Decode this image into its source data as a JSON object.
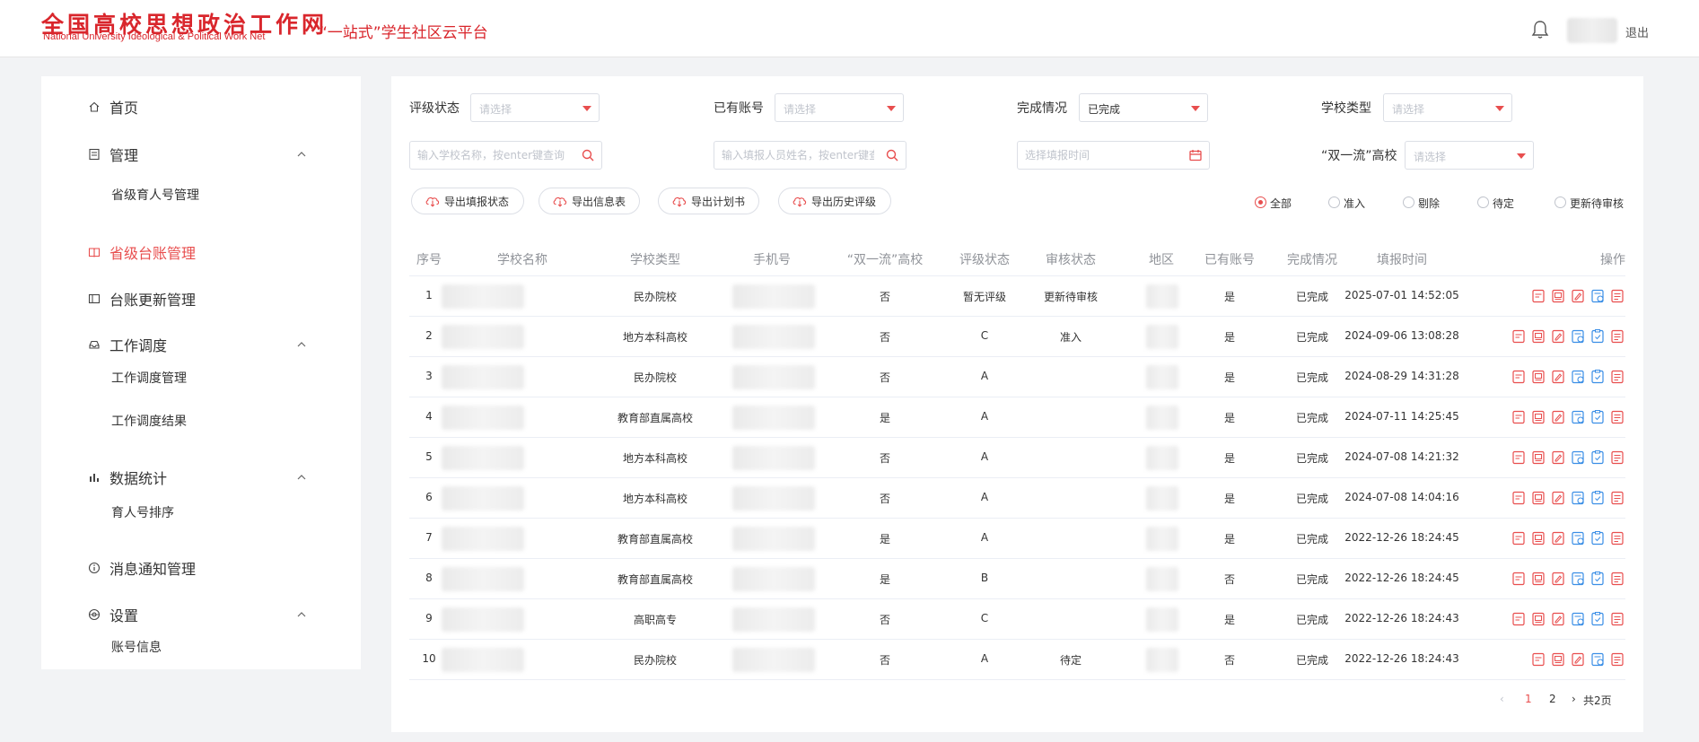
{
  "header": {
    "logo_cn": "全国高校思想政治工作网",
    "logo_en": "National University Ideological & Political Work Net",
    "platform": "“一站式”学生社区云平台",
    "logout": "退出"
  },
  "sidebar": {
    "items": [
      {
        "label": "首页",
        "icon": "home-icon"
      },
      {
        "label": "管理",
        "icon": "document-icon",
        "expanded": true,
        "children": [
          "省级育人号管理"
        ]
      },
      {
        "label": "省级台账管理",
        "icon": "book-icon",
        "active": true
      },
      {
        "label": "台账更新管理",
        "icon": "ledger-icon"
      },
      {
        "label": "工作调度",
        "icon": "tray-icon",
        "expanded": true,
        "children": [
          "工作调度管理",
          "工作调度结果"
        ]
      },
      {
        "label": "数据统计",
        "icon": "bar-chart-icon",
        "expanded": true,
        "children": [
          "育人号排序"
        ]
      },
      {
        "label": "消息通知管理",
        "icon": "info-icon"
      },
      {
        "label": "设置",
        "icon": "settings-icon",
        "expanded": true,
        "children": [
          "账号信息"
        ]
      }
    ]
  },
  "filters": {
    "rating_status": {
      "label": "评级状态",
      "placeholder": "请选择",
      "value": ""
    },
    "has_account": {
      "label": "已有账号",
      "placeholder": "请选择",
      "value": ""
    },
    "completion": {
      "label": "完成情况",
      "placeholder": "请选择",
      "value": "已完成"
    },
    "school_type": {
      "label": "学校类型",
      "placeholder": "请选择",
      "value": ""
    },
    "school_name_search": {
      "placeholder": "输入学校名称，按enter键查询"
    },
    "filler_name_search": {
      "placeholder": "输入填报人员姓名，按enter键查询"
    },
    "fill_time": {
      "placeholder": "选择填报时间"
    },
    "double_first_class": {
      "label": "“双一流”高校",
      "placeholder": "请选择",
      "value": ""
    }
  },
  "export_buttons": [
    "导出填报状态",
    "导出信息表",
    "导出计划书",
    "导出历史评级"
  ],
  "review_filter": {
    "options": [
      "全部",
      "准入",
      "剔除",
      "待定",
      "更新待审核"
    ],
    "selected": "全部"
  },
  "table": {
    "columns": [
      "序号",
      "学校名称",
      "学校类型",
      "手机号",
      "“双一流”高校",
      "评级状态",
      "审核状态",
      "地区",
      "已有账号",
      "完成情况",
      "填报时间",
      "操作"
    ],
    "rows": [
      {
        "no": "1",
        "type": "民办院校",
        "double": "否",
        "rating": "暂无评级",
        "review": "更新待审核",
        "account": "是",
        "done": "已完成",
        "time": "2025-07-01 14:52:05",
        "op_count": 5
      },
      {
        "no": "2",
        "type": "地方本科高校",
        "double": "否",
        "rating": "C",
        "review": "准入",
        "account": "是",
        "done": "已完成",
        "time": "2024-09-06 13:08:28",
        "op_count": 6
      },
      {
        "no": "3",
        "type": "民办院校",
        "double": "否",
        "rating": "A",
        "review": "",
        "account": "是",
        "done": "已完成",
        "time": "2024-08-29 14:31:28",
        "op_count": 6
      },
      {
        "no": "4",
        "type": "教育部直属高校",
        "double": "是",
        "rating": "A",
        "review": "",
        "account": "是",
        "done": "已完成",
        "time": "2024-07-11 14:25:45",
        "op_count": 6
      },
      {
        "no": "5",
        "type": "地方本科高校",
        "double": "否",
        "rating": "A",
        "review": "",
        "account": "是",
        "done": "已完成",
        "time": "2024-07-08 14:21:32",
        "op_count": 6
      },
      {
        "no": "6",
        "type": "地方本科高校",
        "double": "否",
        "rating": "A",
        "review": "",
        "account": "是",
        "done": "已完成",
        "time": "2024-07-08 14:04:16",
        "op_count": 6
      },
      {
        "no": "7",
        "type": "教育部直属高校",
        "double": "是",
        "rating": "A",
        "review": "",
        "account": "是",
        "done": "已完成",
        "time": "2022-12-26 18:24:45",
        "op_count": 6
      },
      {
        "no": "8",
        "type": "教育部直属高校",
        "double": "是",
        "rating": "B",
        "review": "",
        "account": "否",
        "done": "已完成",
        "time": "2022-12-26 18:24:45",
        "op_count": 6
      },
      {
        "no": "9",
        "type": "高职高专",
        "double": "否",
        "rating": "C",
        "review": "",
        "account": "是",
        "done": "已完成",
        "time": "2022-12-26 18:24:43",
        "op_count": 6
      },
      {
        "no": "10",
        "type": "民办院校",
        "double": "否",
        "rating": "A",
        "review": "待定",
        "account": "否",
        "done": "已完成",
        "time": "2022-12-26 18:24:43",
        "op_count": 5
      }
    ]
  },
  "pagination": {
    "pages": [
      "1",
      "2"
    ],
    "current": "1",
    "total": "共2页"
  },
  "colors": {
    "accent": "#e84e4e",
    "brand": "#d9262c",
    "blue_icon": "#3a8ee6"
  }
}
